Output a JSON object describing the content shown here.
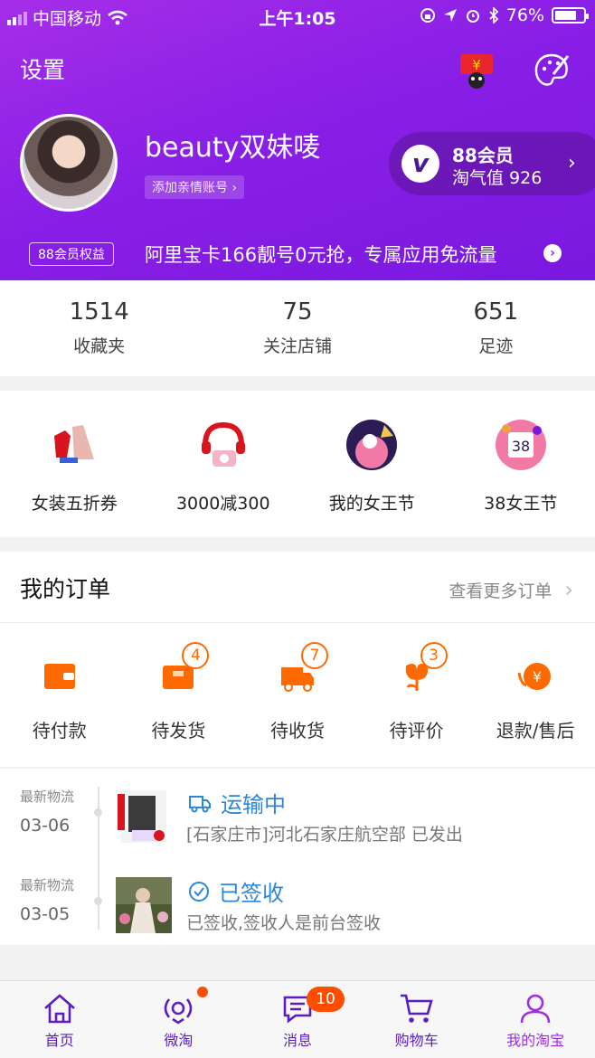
{
  "status_bar": {
    "carrier": "中国移动",
    "time": "上午1:05",
    "battery": "76%"
  },
  "header": {
    "settings_label": "设置",
    "username": "beauty双妹唛",
    "add_family_label": "添加亲情账号 ›",
    "vip": {
      "title": "88会员",
      "subtitle": "淘气值 926"
    },
    "promo_tag": "88会员权益",
    "promo_text": "阿里宝卡166靓号0元抢，专属应用免流量"
  },
  "stats": [
    {
      "num": "1514",
      "label": "收藏夹"
    },
    {
      "num": "75",
      "label": "关注店铺"
    },
    {
      "num": "651",
      "label": "足迹"
    }
  ],
  "promos": [
    {
      "label": "女装五折券"
    },
    {
      "label": "3000减300"
    },
    {
      "label": "我的女王节"
    },
    {
      "label": "38女王节"
    }
  ],
  "orders": {
    "title": "我的订单",
    "more": "查看更多订单",
    "items": [
      {
        "label": "待付款",
        "badge": ""
      },
      {
        "label": "待发货",
        "badge": "4"
      },
      {
        "label": "待收货",
        "badge": "7"
      },
      {
        "label": "待评价",
        "badge": "3"
      },
      {
        "label": "退款/售后",
        "badge": ""
      }
    ]
  },
  "logistics": [
    {
      "meta": "最新物流",
      "date": "03-06",
      "status": "运输中",
      "desc": "[石家庄市]河北石家庄航空部 已发出"
    },
    {
      "meta": "最新物流",
      "date": "03-05",
      "status": "已签收",
      "desc": "已签收,签收人是前台签收"
    }
  ],
  "tabs": [
    {
      "label": "首页"
    },
    {
      "label": "微淘"
    },
    {
      "label": "消息",
      "badge": "10"
    },
    {
      "label": "购物车"
    },
    {
      "label": "我的淘宝"
    }
  ],
  "colors": {
    "brand_purple": "#8a1fe6",
    "order_orange": "#ff6a00",
    "logistics_blue": "#2c86d8"
  }
}
